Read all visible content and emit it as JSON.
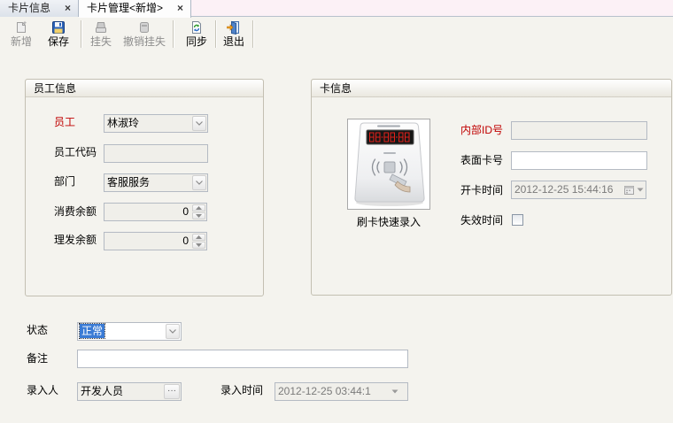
{
  "tabs": [
    {
      "label": "卡片信息",
      "close": "×",
      "active": false
    },
    {
      "label": "卡片管理<新增>",
      "close": "×",
      "active": true
    }
  ],
  "toolbar": {
    "buttons": [
      {
        "label": "新增",
        "icon": "new-record-icon",
        "disabled": true
      },
      {
        "label": "保存",
        "icon": "save-icon",
        "disabled": false
      },
      {
        "label": "挂失",
        "icon": "report-loss-icon",
        "disabled": true
      },
      {
        "label": "撤销挂失",
        "icon": "cancel-report-loss-icon",
        "disabled": true
      },
      {
        "label": "同步",
        "icon": "sync-icon",
        "disabled": false
      },
      {
        "label": "退出",
        "icon": "exit-icon",
        "disabled": false
      }
    ]
  },
  "employee_info": {
    "title": "员工信息",
    "employee": {
      "label": "员工",
      "value": "林淑玲"
    },
    "employee_code": {
      "label": "员工代码",
      "value": ""
    },
    "department": {
      "label": "部门",
      "value": "客服服务"
    },
    "consume_balance": {
      "label": "消费余额",
      "value": "0"
    },
    "haircut_balance": {
      "label": "理发余额",
      "value": "0"
    }
  },
  "card_info": {
    "title": "卡信息",
    "reader": {
      "icon": "card-reader-image",
      "caption": "刷卡快速录入"
    },
    "internal_id": {
      "label": "内部ID号",
      "value": ""
    },
    "surface_no": {
      "label": "表面卡号",
      "value": ""
    },
    "open_time": {
      "label": "开卡时间",
      "value": "2012-12-25 15:44:16"
    },
    "expire_time": {
      "label": "失效时间",
      "checked": false
    }
  },
  "record": {
    "status": {
      "label": "状态",
      "value": "正常"
    },
    "remark": {
      "label": "备注",
      "value": ""
    },
    "entered_by": {
      "label": "录入人",
      "value": "开发人员",
      "button": "···"
    },
    "entry_time": {
      "label": "录入时间",
      "value": "2012-12-25 03:44:1"
    }
  },
  "colors": {
    "required_label": "#c00000",
    "selection": "#3a7bd5",
    "background": "#f4f3ee"
  }
}
